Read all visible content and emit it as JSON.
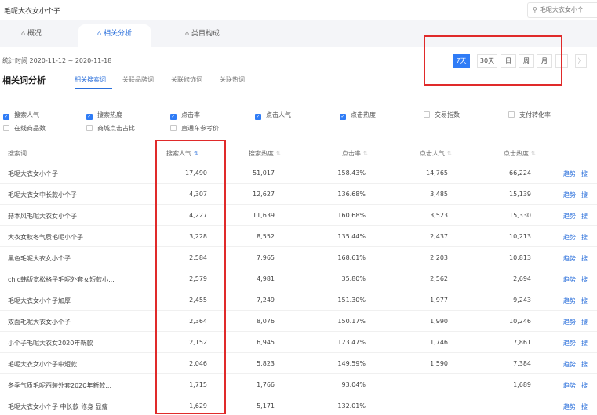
{
  "product_title": "毛呢大衣女小个子",
  "search": {
    "value": "毛呢大衣女小个"
  },
  "main_tabs": [
    {
      "label": "概况",
      "icon": "home-icon",
      "active": false
    },
    {
      "label": "相关分析",
      "icon": "home-icon",
      "active": true
    },
    {
      "label": "类目构成",
      "icon": "home-icon",
      "active": false
    }
  ],
  "stat_date": "统计时间 2020-11-12 ~ 2020-11-18",
  "period_buttons": [
    {
      "label": "7天",
      "active": true
    },
    {
      "label": "30天",
      "active": false
    },
    {
      "label": "日",
      "active": false
    },
    {
      "label": "周",
      "active": false
    },
    {
      "label": "月",
      "active": false
    },
    {
      "label": "",
      "active": false
    },
    {
      "label": "〉",
      "active": false
    }
  ],
  "section_title": "相关词分析",
  "sub_tabs": [
    {
      "label": "相关搜索词",
      "active": true
    },
    {
      "label": "关联品牌词",
      "active": false
    },
    {
      "label": "关联修饰词",
      "active": false
    },
    {
      "label": "关联热词",
      "active": false
    }
  ],
  "metric_checkboxes": [
    {
      "label": "搜索人气",
      "checked": true
    },
    {
      "label": "搜索热度",
      "checked": true
    },
    {
      "label": "点击率",
      "checked": true
    },
    {
      "label": "点击人气",
      "checked": true
    },
    {
      "label": "点击热度",
      "checked": true
    },
    {
      "label": "交易指数",
      "checked": false
    },
    {
      "label": "支付转化率",
      "checked": false
    },
    {
      "label": "在线商品数",
      "checked": false
    },
    {
      "label": "商城点击占比",
      "checked": false
    },
    {
      "label": "直通车参考价",
      "checked": false
    }
  ],
  "table": {
    "headers": [
      "搜索词",
      "搜索人气",
      "搜索热度",
      "点击率",
      "点击人气",
      "点击热度"
    ],
    "sort_icon": "sort-arrows-icon",
    "action_labels": [
      "趋势",
      "搜"
    ],
    "rows": [
      [
        "毛呢大衣女小个子",
        "17,490",
        "51,017",
        "158.43%",
        "14,765",
        "66,224"
      ],
      [
        "毛呢大衣女中长款小个子",
        "4,307",
        "12,627",
        "136.68%",
        "3,485",
        "15,139"
      ],
      [
        "赫本风毛呢大衣女小个子",
        "4,227",
        "11,639",
        "160.68%",
        "3,523",
        "15,330"
      ],
      [
        "大衣女秋冬气质毛呢小个子",
        "3,228",
        "8,552",
        "135.44%",
        "2,437",
        "10,213"
      ],
      [
        "黑色毛呢大衣女小个子",
        "2,584",
        "7,965",
        "168.61%",
        "2,203",
        "10,813"
      ],
      [
        "chic韩版宽松格子毛呢外套女短款小...",
        "2,579",
        "4,981",
        "35.80%",
        "2,562",
        "2,694"
      ],
      [
        "毛呢大衣女小个子加厚",
        "2,455",
        "7,249",
        "151.30%",
        "1,977",
        "9,243"
      ],
      [
        "双面毛呢大衣女小个子",
        "2,364",
        "8,076",
        "150.17%",
        "1,990",
        "10,246"
      ],
      [
        "小个子毛呢大衣女2020年新款",
        "2,152",
        "6,945",
        "123.47%",
        "1,746",
        "7,861"
      ],
      [
        "毛呢大衣女小个子中短款",
        "2,046",
        "5,823",
        "149.59%",
        "1,590",
        "7,384"
      ],
      [
        "冬季气质毛呢西装外套2020年新款...",
        "1,715",
        "1,766",
        "93.04%",
        "",
        "1,689"
      ],
      [
        "毛呢大衣女小个子 中长款 修身 显瘦",
        "1,629",
        "5,171",
        "132.01%",
        "",
        ""
      ]
    ]
  },
  "colors": {
    "accent": "#2f7cf6",
    "highlight": "#e02a2a",
    "tab_bg": "#f4f5f8"
  }
}
